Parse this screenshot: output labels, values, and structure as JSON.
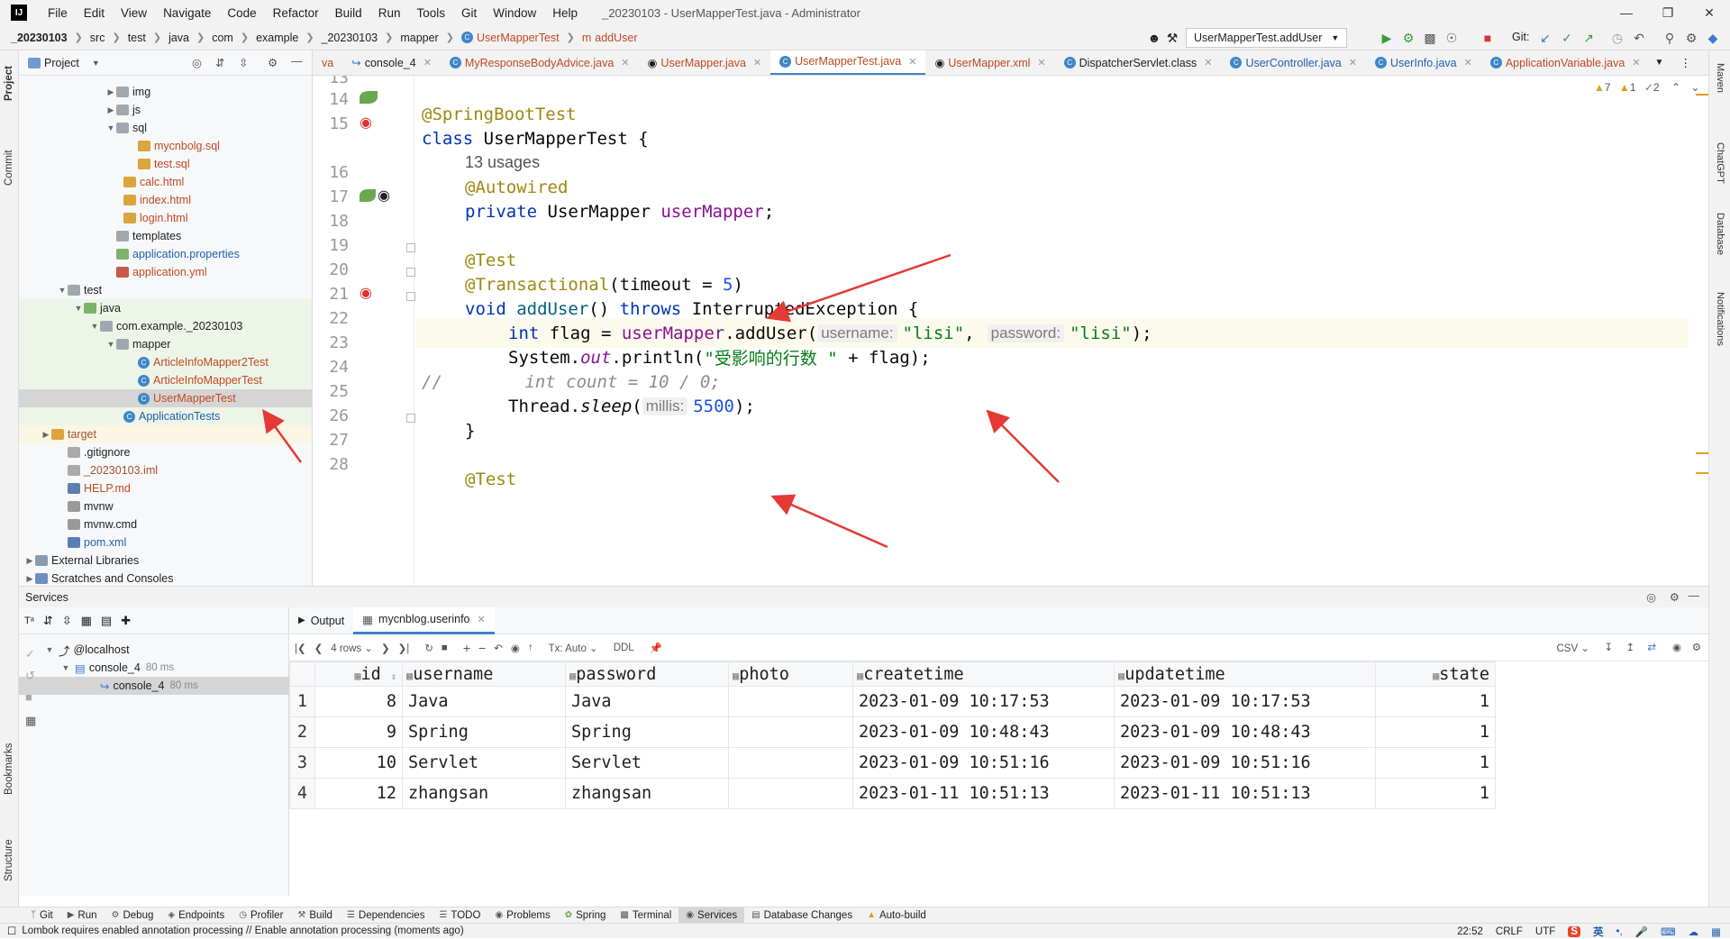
{
  "window": {
    "title": "_20230103 - UserMapperTest.java - Administrator",
    "menu": [
      "File",
      "Edit",
      "View",
      "Navigate",
      "Code",
      "Refactor",
      "Build",
      "Run",
      "Tools",
      "Git",
      "Window",
      "Help"
    ]
  },
  "breadcrumb": [
    "_20230103",
    "src",
    "test",
    "java",
    "com",
    "example",
    "_20230103",
    "mapper",
    "UserMapperTest",
    "addUser"
  ],
  "toolbar": {
    "run_config": "UserMapperTest.addUser",
    "git_label": "Git:"
  },
  "left_stripe": [
    "Project",
    "Commit",
    "Bookmarks",
    "Structure"
  ],
  "right_stripe": [
    "Maven",
    "ChatGPT",
    "Database",
    "Notifications"
  ],
  "project": {
    "header": "Project",
    "tree": [
      {
        "label": "img",
        "kind": "folder"
      },
      {
        "label": "js",
        "kind": "folder"
      },
      {
        "label": "sql",
        "kind": "folder"
      },
      {
        "label": "mycnbolg.sql",
        "kind": "sql"
      },
      {
        "label": "test.sql",
        "kind": "sql"
      },
      {
        "label": "calc.html",
        "kind": "html"
      },
      {
        "label": "index.html",
        "kind": "html"
      },
      {
        "label": "login.html",
        "kind": "html"
      },
      {
        "label": "templates",
        "kind": "folder"
      },
      {
        "label": "application.properties",
        "kind": "props"
      },
      {
        "label": "application.yml",
        "kind": "yml"
      },
      {
        "label": "test",
        "kind": "folder"
      },
      {
        "label": "java",
        "kind": "folder-g"
      },
      {
        "label": "com.example._20230103",
        "kind": "folder"
      },
      {
        "label": "mapper",
        "kind": "folder"
      },
      {
        "label": "ArticleInfoMapper2Test",
        "kind": "class"
      },
      {
        "label": "ArticleInfoMapperTest",
        "kind": "class"
      },
      {
        "label": "UserMapperTest",
        "kind": "class"
      },
      {
        "label": "ApplicationTests",
        "kind": "class"
      },
      {
        "label": "target",
        "kind": "folder-y"
      },
      {
        "label": ".gitignore",
        "kind": "file"
      },
      {
        "label": "_20230103.iml",
        "kind": "file"
      },
      {
        "label": "HELP.md",
        "kind": "md"
      },
      {
        "label": "mvnw",
        "kind": "file"
      },
      {
        "label": "mvnw.cmd",
        "kind": "file"
      },
      {
        "label": "pom.xml",
        "kind": "xml"
      },
      {
        "label": "External Libraries",
        "kind": "lib"
      },
      {
        "label": "Scratches and Consoles",
        "kind": "scratch"
      }
    ]
  },
  "editor_tabs": [
    {
      "label": "va"
    },
    {
      "label": "console_4"
    },
    {
      "label": "MyResponseBodyAdvice.java"
    },
    {
      "label": "UserMapper.java"
    },
    {
      "label": "UserMapperTest.java",
      "active": true
    },
    {
      "label": "UserMapper.xml"
    },
    {
      "label": "DispatcherServlet.class"
    },
    {
      "label": "UserController.java"
    },
    {
      "label": "UserInfo.java"
    },
    {
      "label": "ApplicationVariable.java"
    }
  ],
  "inspections": {
    "warnings": "7",
    "weak": "1",
    "typos": "2"
  },
  "code": {
    "line_numbers": [
      "13",
      "14",
      "15",
      "16",
      "17",
      "18",
      "19",
      "20",
      "21",
      "22",
      "23",
      "24",
      "25",
      "26",
      "27",
      "28"
    ],
    "l14": "@SpringBootTest",
    "l15_kw": "class",
    "l15_name": " UserMapperTest {",
    "usages": "13 usages",
    "l16": "@Autowired",
    "l17_kw": "private",
    "l17_type": " UserMapper ",
    "l17_field": "userMapper",
    "l17_end": ";",
    "l19": "@Test",
    "l20_ann": "@Transactional",
    "l20_a": "(timeout = ",
    "l20_num": "5",
    "l20_b": ")",
    "l21_kw": "void",
    "l21_name": " addUser",
    "l21_b": "() ",
    "l21_throws": "throws",
    "l21_c": " InterruptedException {",
    "l22_kw": "int",
    "l22_a": " flag = ",
    "l22_field": "userMapper",
    "l22_b": ".addUser(",
    "l22_hint1": "username:",
    "l22_str1": "\"lisi\"",
    "l22_c": ",",
    "l22_hint2": "password:",
    "l22_str2": "\"lisi\"",
    "l22_d": ");",
    "l23_a": "System.",
    "l23_out": "out",
    "l23_b": ".println(",
    "l23_str": "\"受影响的行数 \"",
    "l23_c": " + flag);",
    "l24": "//        int count = 10 / 0;",
    "l25_a": "Thread.",
    "l25_sleep": "sleep",
    "l25_b": "(",
    "l25_hint": "millis:",
    "l25_num": "5500",
    "l25_c": ");",
    "l26": "}",
    "l28": "@Test"
  },
  "services": {
    "title": "Services",
    "tree": [
      {
        "label": "@localhost",
        "meta": ""
      },
      {
        "label": "console_4",
        "meta": "80 ms"
      },
      {
        "label": "console_4",
        "meta": "80 ms"
      }
    ],
    "tabs": [
      "Output",
      "mycnblog.userinfo"
    ],
    "rows_label": "4 rows",
    "tx_label": "Tx: Auto",
    "ddl_label": "DDL",
    "csv_label": "CSV",
    "columns": [
      "id",
      "username",
      "password",
      "photo",
      "createtime",
      "updatetime",
      "state"
    ],
    "rows": [
      [
        "1",
        "8",
        "Java",
        "Java",
        "",
        "2023-01-09 10:17:53",
        "2023-01-09 10:17:53",
        "1"
      ],
      [
        "2",
        "9",
        "Spring",
        "Spring",
        "",
        "2023-01-09 10:48:43",
        "2023-01-09 10:48:43",
        "1"
      ],
      [
        "3",
        "10",
        "Servlet",
        "Servlet",
        "",
        "2023-01-09 10:51:16",
        "2023-01-09 10:51:16",
        "1"
      ],
      [
        "4",
        "12",
        "zhangsan",
        "zhangsan",
        "",
        "2023-01-11 10:51:13",
        "2023-01-11 10:51:13",
        "1"
      ]
    ]
  },
  "bottom_tools": [
    "Git",
    "Run",
    "Debug",
    "Endpoints",
    "Profiler",
    "Build",
    "Dependencies",
    "TODO",
    "Problems",
    "Spring",
    "Terminal",
    "Services",
    "Database Changes",
    "Auto-build"
  ],
  "status": {
    "message": "Lombok requires enabled annotation processing // Enable annotation processing (moments ago)",
    "position": "22:52",
    "line_sep": "CRLF",
    "encoding": "UTF",
    "ime_lang": "英"
  },
  "colors": {
    "accent": "#4083c9",
    "annotation_arrow": "#e53935",
    "keyword": "#0033b3",
    "string": "#067d17"
  }
}
